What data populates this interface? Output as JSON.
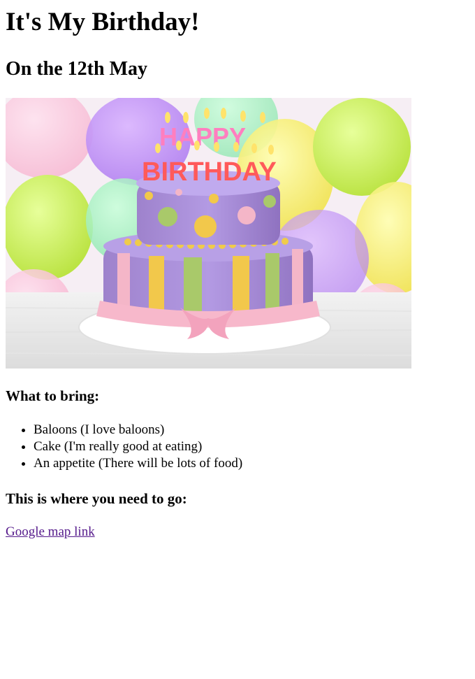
{
  "page": {
    "title": "It's My Birthday!",
    "subtitle": "On the 12th May"
  },
  "image": {
    "alt": "Birthday cake",
    "banner_text": "HAPPY BIRTHDAY",
    "top_word": "HAPPY",
    "bottom_word": "BIRTHDAY"
  },
  "bring": {
    "heading": "What to bring:",
    "items": [
      "Baloons (I love baloons)",
      "Cake (I'm really good at eating)",
      "An appetite (There will be lots of food)"
    ]
  },
  "directions": {
    "heading": "This is where you need to go:",
    "link_text": "Google map link"
  },
  "colors": {
    "link_visited": "#551a8b",
    "cake_purple": "#a98bd6",
    "cake_yellow": "#f2c84b",
    "cake_green": "#a9c96a",
    "cake_pink": "#f4b6c8"
  }
}
